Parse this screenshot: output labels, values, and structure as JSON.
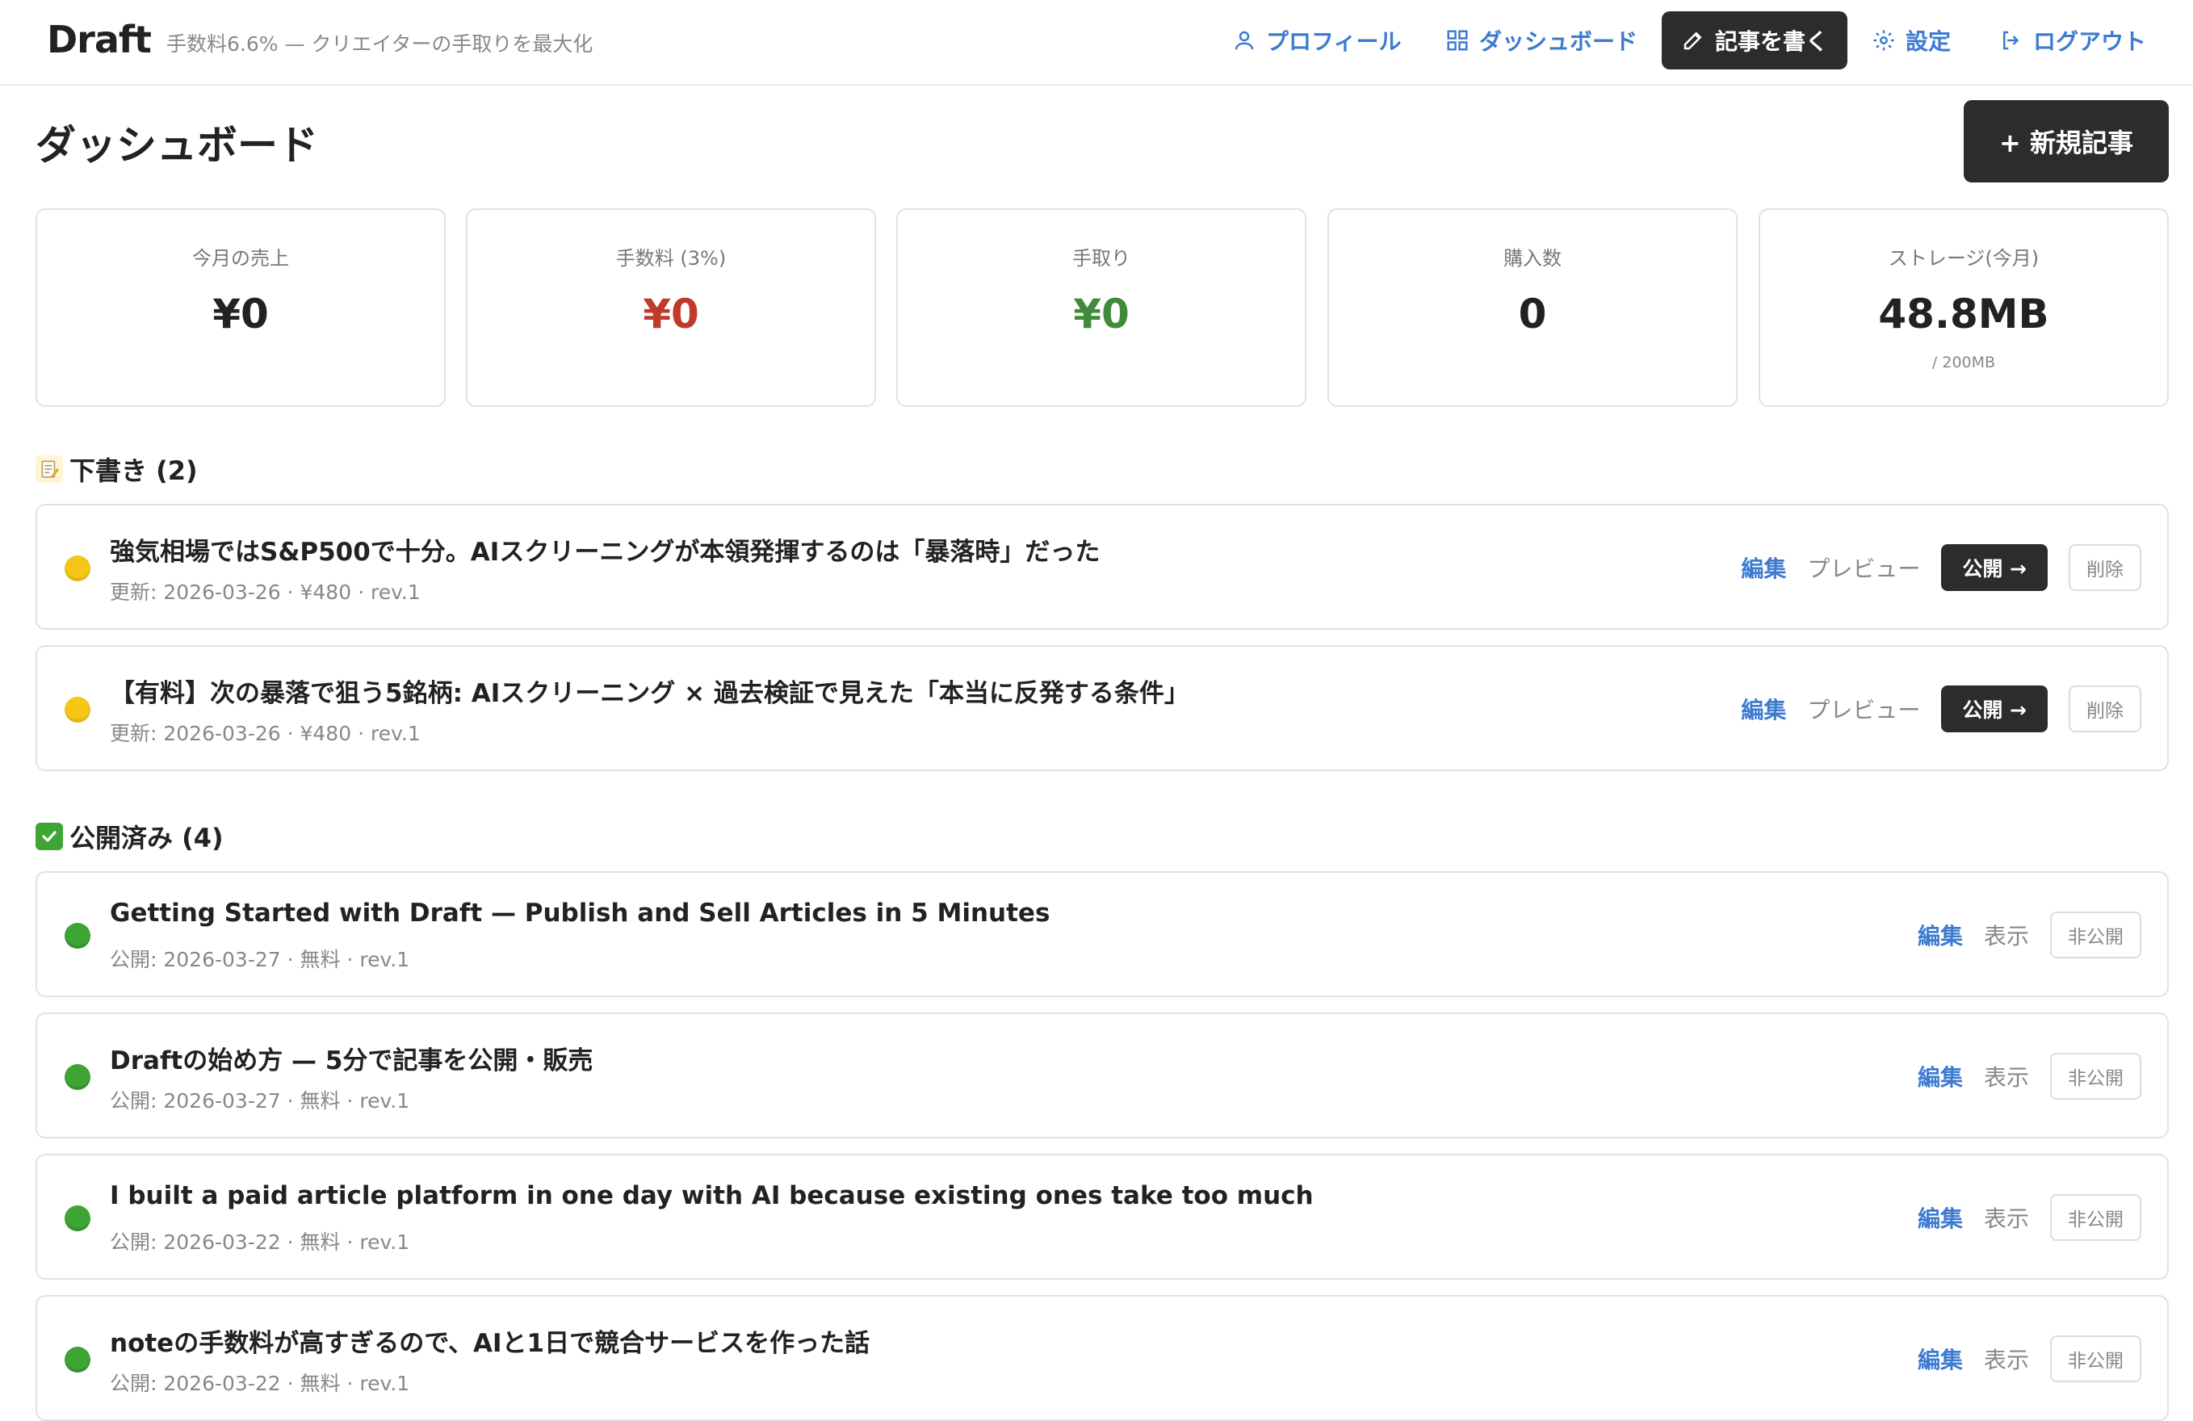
{
  "header": {
    "logo": "Draft",
    "tagline": "手数料6.6% — クリエイターの手取りを最大化",
    "nav": {
      "profile": "プロフィール",
      "dashboard": "ダッシュボード",
      "write": "記事を書く",
      "settings": "設定",
      "logout": "ログアウト"
    }
  },
  "page": {
    "title": "ダッシュボード",
    "new_article": "+ 新規記事"
  },
  "stats": [
    {
      "label": "今月の売上",
      "value": "¥0",
      "color": "#222222"
    },
    {
      "label": "手数料 (3%)",
      "value": "¥0",
      "color": "#c0392b"
    },
    {
      "label": "手取り",
      "value": "¥0",
      "color": "#3f8b3a"
    },
    {
      "label": "購入数",
      "value": "0",
      "color": "#222222"
    },
    {
      "label": "ストレージ(今月)",
      "value": "48.8MB",
      "sub": "/ 200MB",
      "color": "#222222"
    }
  ],
  "drafts": {
    "title": "下書き (2)",
    "icon": "memo",
    "actions": {
      "edit": "編集",
      "preview": "プレビュー",
      "publish": "公開 →",
      "delete": "削除"
    },
    "items": [
      {
        "title": "強気相場ではS&P500で十分。AIスクリーニングが本領発揮するのは「暴落時」だった",
        "meta": "更新: 2026-03-26 · ¥480 · rev.1"
      },
      {
        "title": "【有料】次の暴落で狙う5銘柄: AIスクリーニング × 過去検証で見えた「本当に反発する条件」",
        "meta": "更新: 2026-03-26 · ¥480 · rev.1"
      }
    ]
  },
  "published": {
    "title": "公開済み (4)",
    "icon": "check-mark",
    "actions": {
      "edit": "編集",
      "view": "表示",
      "unpublish": "非公開"
    },
    "items": [
      {
        "title": "Getting Started with Draft — Publish and Sell Articles in 5 Minutes",
        "meta": "公開: 2026-03-27 · 無料 · rev.1"
      },
      {
        "title": "Draftの始め方 — 5分で記事を公開・販売",
        "meta": "公開: 2026-03-27 · 無料 · rev.1"
      },
      {
        "title": "I built a paid article platform in one day with AI because existing ones take too much",
        "meta": "公開: 2026-03-22 · 無料 · rev.1"
      },
      {
        "title": "noteの手数料が高すぎるので、AIと1日で競合サービスを作った話",
        "meta": "公開: 2026-03-22 · 無料 · rev.1"
      }
    ]
  },
  "colors": {
    "accent": "#3d7bd1",
    "dark_button": "#2c2c2c",
    "draft_dot": "#f5c518",
    "published_dot": "#3ea535"
  }
}
